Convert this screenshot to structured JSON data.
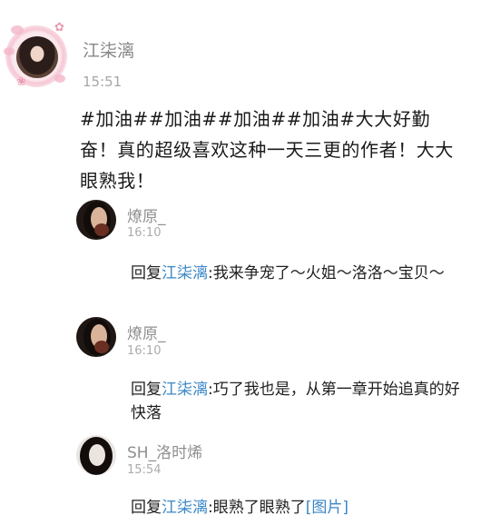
{
  "main_comment": {
    "user": "江柒漓",
    "time": "15:51",
    "text": "#加油##加油##加油##加油#大大好勤奋！真的超级喜欢这种一天三更的作者！大大眼熟我！"
  },
  "replies": [
    {
      "user": "燎原_",
      "time": "16:10",
      "prefix": "回复",
      "mention": "江柒漓",
      "text": ":我来争宠了～火姐～洛洛～宝贝～"
    },
    {
      "user": "燎原_",
      "time": "16:10",
      "prefix": "回复",
      "mention": "江柒漓",
      "text": ":巧了我也是，从第一章开始追真的好快落"
    },
    {
      "user": "SH_洛时烯",
      "time": "15:54",
      "prefix": "回复",
      "mention": "江柒漓",
      "text": ":眼熟了眼熟了",
      "attachment": "[图片]"
    }
  ],
  "colors": {
    "link": "#3b87c6",
    "name": "#888888",
    "time": "#a6a6a6"
  }
}
